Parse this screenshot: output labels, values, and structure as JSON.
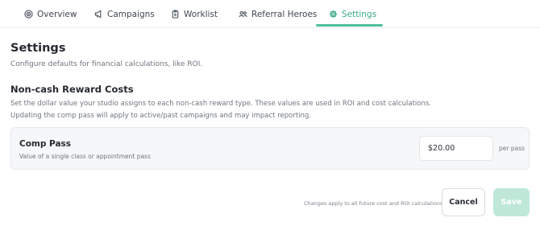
{
  "tabs": [
    {
      "label": "Overview",
      "icon": "target-icon"
    },
    {
      "label": "Campaigns",
      "icon": "megaphone-icon"
    },
    {
      "label": "Worklist",
      "icon": "clipboard-icon"
    },
    {
      "label": "Referral Heroes",
      "icon": "users-icon"
    },
    {
      "label": "Settings",
      "icon": "gear-icon",
      "active": true
    }
  ],
  "page": {
    "title": "Settings",
    "description": "Configure defaults for financial calculations, like ROI."
  },
  "section": {
    "title": "Non-cash Reward Costs",
    "description_line1": "Set the dollar value your studio assigns to each non-cash reward type. These values are used in ROI and cost calculations.",
    "description_line2": "Updating the comp pass will apply to active/past campaigns and may impact reporting."
  },
  "reward_card": {
    "title": "Comp Pass",
    "subtitle": "Value of a single class or appointment pass",
    "value": "$20.00",
    "unit": "per pass"
  },
  "footer": {
    "note": "Changes apply to all future cost and ROI calculations.",
    "cancel_label": "Cancel",
    "save_label": "Save"
  },
  "colors": {
    "accent": "#3aaa87",
    "save_disabled": "#bfe8d9"
  }
}
